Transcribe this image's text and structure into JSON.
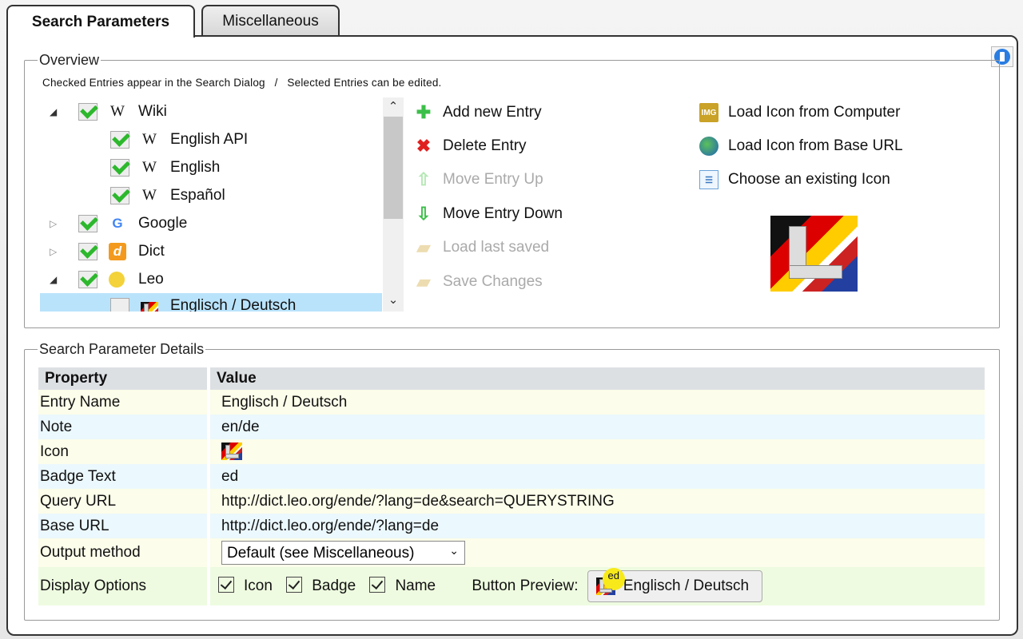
{
  "tabs": [
    {
      "label": "Search Parameters",
      "active": true
    },
    {
      "label": "Miscellaneous",
      "active": false
    }
  ],
  "overview": {
    "legend": "Overview",
    "hint": "Checked Entries appear in the Search Dialog   /   Selected Entries can be edited.",
    "tree": [
      {
        "label": "Wiki",
        "checked": true,
        "expanded": true,
        "icon": "wikipedia-icon"
      },
      {
        "label": "English API",
        "checked": true,
        "icon": "wikipedia-icon"
      },
      {
        "label": "English",
        "checked": true,
        "icon": "wikipedia-icon"
      },
      {
        "label": "Español",
        "checked": true,
        "icon": "wikipedia-icon"
      },
      {
        "label": "Google",
        "checked": true,
        "expanded": false,
        "icon": "google-icon"
      },
      {
        "label": "Dict",
        "checked": true,
        "expanded": false,
        "icon": "dict-icon"
      },
      {
        "label": "Leo",
        "checked": true,
        "expanded": true,
        "icon": "leo-icon"
      },
      {
        "label": "Englisch / Deutsch",
        "checked": false,
        "selected": true,
        "icon": "leo-flag-icon"
      }
    ],
    "actions": [
      {
        "label": "Add new Entry",
        "enabled": true,
        "icon": "plus-icon"
      },
      {
        "label": "Delete Entry",
        "enabled": true,
        "icon": "delete-icon"
      },
      {
        "label": "Move Entry Up",
        "enabled": false,
        "icon": "arrow-up-icon"
      },
      {
        "label": "Move Entry Down",
        "enabled": true,
        "icon": "arrow-down-icon"
      },
      {
        "label": "Load last saved",
        "enabled": false,
        "icon": "folder-load-icon"
      },
      {
        "label": "Save Changes",
        "enabled": false,
        "icon": "folder-save-icon"
      }
    ],
    "icon_actions": [
      {
        "label": "Load Icon from Computer",
        "icon": "image-upload-icon"
      },
      {
        "label": "Load Icon from Base URL",
        "icon": "globe-icon"
      },
      {
        "label": "Choose an existing Icon",
        "icon": "icon-list-icon"
      }
    ]
  },
  "details": {
    "legend": "Search Parameter Details",
    "headers": {
      "property": "Property",
      "value": "Value"
    },
    "rows": {
      "entry_name": {
        "label": "Entry Name",
        "value": "Englisch / Deutsch"
      },
      "note": {
        "label": "Note",
        "value": "en/de"
      },
      "icon": {
        "label": "Icon"
      },
      "badge_text": {
        "label": "Badge Text",
        "value": "ed"
      },
      "query_url": {
        "label": "Query URL",
        "value": "http://dict.leo.org/ende/?lang=de&search=QUERYSTRING"
      },
      "base_url": {
        "label": "Base URL",
        "value": "http://dict.leo.org/ende/?lang=de"
      },
      "output_method": {
        "label": "Output method",
        "value": "Default (see Miscellaneous)"
      },
      "display_options": {
        "label": "Display Options",
        "icon": "Icon",
        "badge": "Badge",
        "name": "Name",
        "icon_checked": true,
        "badge_checked": true,
        "name_checked": true,
        "preview_label": "Button Preview:",
        "preview_badge": "ed",
        "preview_text": "Englisch / Deutsch"
      }
    }
  },
  "colors": {
    "selection": "#b9e3fb",
    "badge": "#f8ea1a",
    "check": "#2db82d"
  }
}
